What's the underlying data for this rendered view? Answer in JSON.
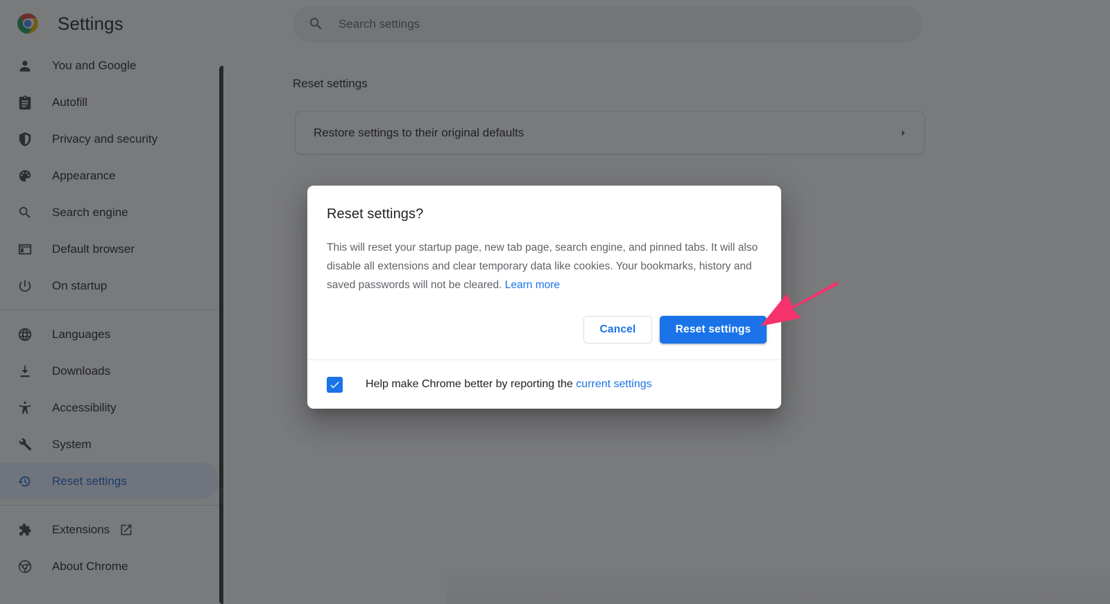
{
  "app": {
    "title": "Settings",
    "logo_icon": "chrome-logo-icon"
  },
  "colors": {
    "accent_blue": "#1a73e8",
    "selected_blue": "#1967d2",
    "selected_bg": "#e8f0fe",
    "text_primary": "#202124",
    "text_secondary": "#5f6368",
    "annotation_pink": "#f5326b",
    "scrim": "rgba(32,33,36,0.60)"
  },
  "sidebar": {
    "groups": [
      {
        "items": [
          {
            "label": "You and Google",
            "icon": "person-icon",
            "selected": false
          },
          {
            "label": "Autofill",
            "icon": "clipboard-icon",
            "selected": false
          },
          {
            "label": "Privacy and security",
            "icon": "shield-icon",
            "selected": false
          },
          {
            "label": "Appearance",
            "icon": "palette-icon",
            "selected": false
          },
          {
            "label": "Search engine",
            "icon": "search-icon",
            "selected": false
          },
          {
            "label": "Default browser",
            "icon": "browser-window-icon",
            "selected": false
          },
          {
            "label": "On startup",
            "icon": "power-icon",
            "selected": false
          }
        ]
      },
      {
        "items": [
          {
            "label": "Languages",
            "icon": "globe-icon",
            "selected": false
          },
          {
            "label": "Downloads",
            "icon": "download-icon",
            "selected": false
          },
          {
            "label": "Accessibility",
            "icon": "accessibility-icon",
            "selected": false
          },
          {
            "label": "System",
            "icon": "wrench-icon",
            "selected": false
          },
          {
            "label": "Reset settings",
            "icon": "history-restore-icon",
            "selected": true
          }
        ]
      },
      {
        "items": [
          {
            "label": "Extensions",
            "icon": "puzzle-icon",
            "selected": false,
            "external": true,
            "external_icon": "open-in-new-icon"
          },
          {
            "label": "About Chrome",
            "icon": "chrome-outline-icon",
            "selected": false
          }
        ]
      }
    ]
  },
  "search": {
    "placeholder": "Search settings",
    "value": "",
    "icon": "search-icon"
  },
  "main": {
    "section_title": "Reset settings",
    "card": {
      "label": "Restore settings to their original defaults",
      "chevron_icon": "chevron-right-icon"
    }
  },
  "dialog": {
    "title": "Reset settings?",
    "body_text_1": "This will reset your startup page, new tab page, search engine, and pinned tabs. It will also disable all extensions and clear temporary data like cookies. Your bookmarks, history and saved passwords will not be cleared. ",
    "learn_more_label": "Learn more",
    "cancel_label": "Cancel",
    "confirm_label": "Reset settings",
    "footer": {
      "checkbox_checked": true,
      "checkbox_icon": "checkmark-icon",
      "text_before": "Help make Chrome better by reporting the ",
      "link_label": "current settings"
    }
  },
  "annotation": {
    "type": "arrow",
    "icon": "pink-arrow-icon",
    "points_to": "Reset settings"
  }
}
